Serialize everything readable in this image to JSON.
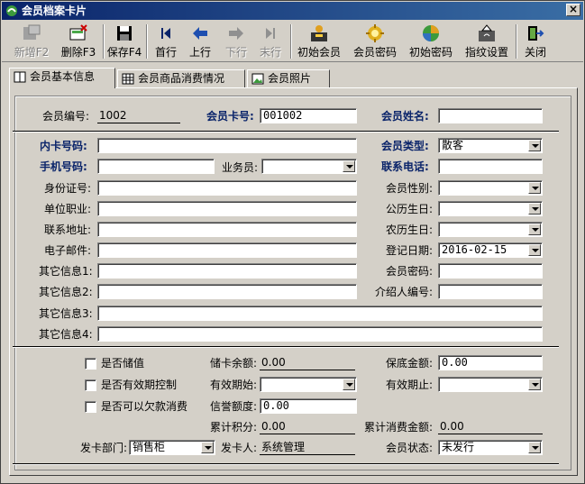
{
  "window": {
    "title": "会员档案卡片",
    "close": "×"
  },
  "toolbar": [
    {
      "name": "new-button",
      "label": "新增F2",
      "icon": "new-card-icon",
      "disabled": true
    },
    {
      "name": "delete-button",
      "label": "删除F3",
      "icon": "delete-card-icon",
      "disabled": false
    },
    {
      "name": "save-button",
      "label": "保存F4",
      "icon": "save-disk-icon",
      "disabled": false
    },
    {
      "name": "first-button",
      "label": "首行",
      "icon": "first-record-icon",
      "disabled": false
    },
    {
      "name": "prev-button",
      "label": "上行",
      "icon": "arrow-left-icon",
      "disabled": false
    },
    {
      "name": "next-button",
      "label": "下行",
      "icon": "arrow-right-icon",
      "disabled": true
    },
    {
      "name": "last-button",
      "label": "末行",
      "icon": "last-record-icon",
      "disabled": true
    },
    {
      "name": "init-member-button",
      "label": "初始会员",
      "icon": "init-member-icon",
      "disabled": false
    },
    {
      "name": "member-password-button",
      "label": "会员密码",
      "icon": "password-gear-icon",
      "disabled": false
    },
    {
      "name": "init-password-button",
      "label": "初始密码",
      "icon": "init-password-icon",
      "disabled": false
    },
    {
      "name": "fingerprint-settings-button",
      "label": "指纹设置",
      "icon": "fingerprint-icon",
      "disabled": false
    },
    {
      "name": "close-button",
      "label": "关闭",
      "icon": "exit-door-icon",
      "disabled": false
    }
  ],
  "tabs": [
    {
      "label": "会员基本信息",
      "active": true
    },
    {
      "label": "会员商品消费情况",
      "active": false
    },
    {
      "label": "会员照片",
      "active": false
    }
  ],
  "form": {
    "member_no_label": "会员编号:",
    "member_no": "1002",
    "card_no_label": "会员卡号:",
    "card_no": "001002",
    "member_name_label": "会员姓名:",
    "member_name": "",
    "inner_card_label": "内卡号码:",
    "inner_card": "",
    "member_type_label": "会员类型:",
    "member_type": "散客",
    "mobile_label": "手机号码:",
    "mobile": "",
    "salesman_label": "业务员:",
    "salesman": "",
    "phone_label": "联系电话:",
    "phone": "",
    "id_card_label": "身份证号:",
    "id_card": "",
    "gender_label": "会员性别:",
    "gender": "",
    "company_label": "单位职业:",
    "company": "",
    "birthday_label": "公历生日:",
    "birthday": "",
    "address_label": "联系地址:",
    "address": "",
    "lunar_birthday_label": "农历生日:",
    "lunar_birthday": "",
    "email_label": "电子邮件:",
    "email": "",
    "reg_date_label": "登记日期:",
    "reg_date": "2016-02-15",
    "other1_label": "其它信息1:",
    "other1": "",
    "password_label": "会员密码:",
    "password": "",
    "other2_label": "其它信息2:",
    "other2": "",
    "referrer_label": "介绍人编号:",
    "referrer": "",
    "other3_label": "其它信息3:",
    "other3": "",
    "other4_label": "其它信息4:",
    "other4": "",
    "stored_value_label": "是否储值",
    "stored_balance_label": "储卡余额:",
    "stored_balance": "0.00",
    "min_amount_label": "保底金额:",
    "min_amount": "0.00",
    "validity_ctrl_label": "是否有效期控制",
    "valid_from_label": "有效期始:",
    "valid_from": "",
    "valid_to_label": "有效期止:",
    "valid_to": "",
    "credit_label": "是否可以欠款消费",
    "credit_limit_label": "信誉额度:",
    "credit_limit": "0.00",
    "points_label": "累计积分:",
    "points": "0.00",
    "total_spent_label": "累计消费金额:",
    "total_spent": "0.00",
    "issue_dept_label": "发卡部门:",
    "issue_dept": "销售柜",
    "issuer_label": "发卡人:",
    "issuer": "系统管理",
    "status_label": "会员状态:",
    "status": "未发行"
  }
}
